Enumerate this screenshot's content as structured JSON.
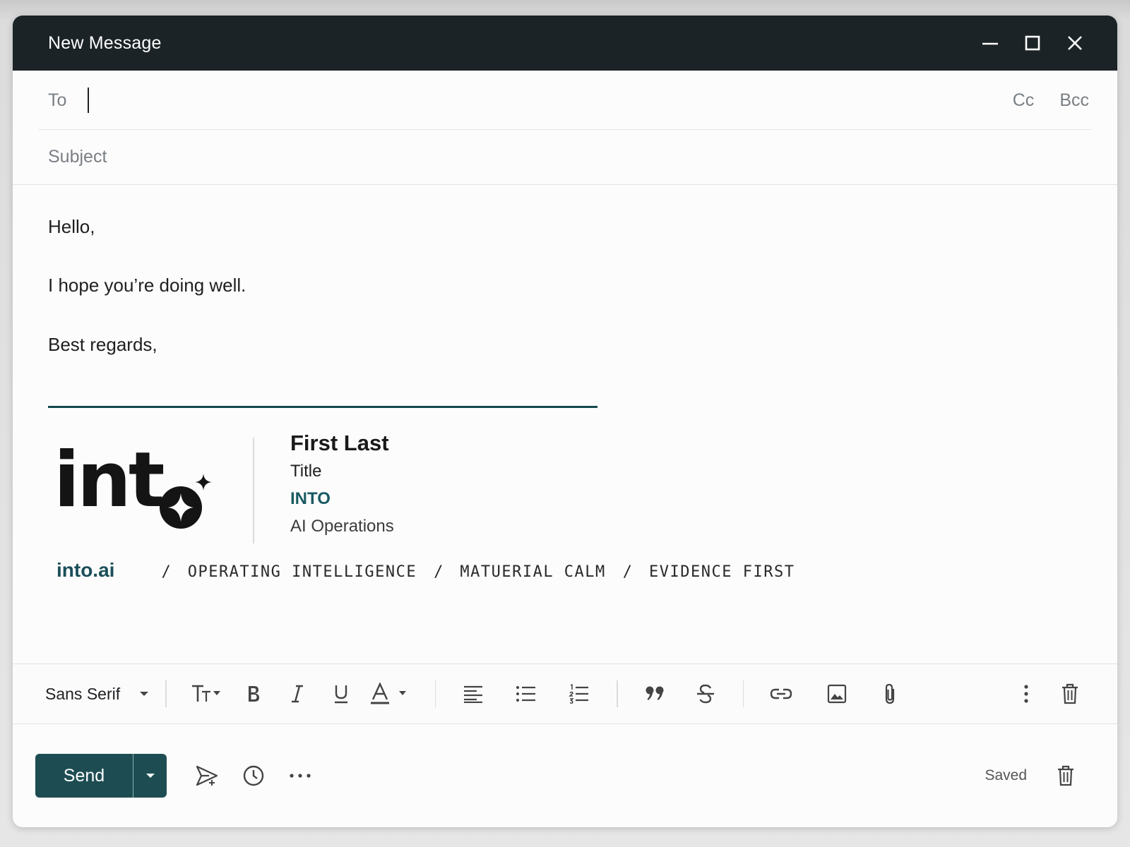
{
  "window": {
    "title": "New Message",
    "controls": [
      "minimize-icon",
      "maximize-icon",
      "close-icon"
    ],
    "titlebar_color": "#1b2326"
  },
  "header": {
    "to_label": "To",
    "to_value": "",
    "cc_label": "Cc",
    "bcc_label": "Bcc",
    "subject_placeholder": "Subject",
    "subject_value": ""
  },
  "body": {
    "lines": [
      "Hello,",
      "I hope you’re doing well.",
      "Best regards,"
    ]
  },
  "signature": {
    "logo_text": "into",
    "name": "First Last",
    "title": "Title",
    "company": "INTO",
    "department": "AI Operations",
    "website": "into.ai",
    "taglines": [
      "OPERATING INTELLIGENCE",
      "MATUERIAL CALM",
      "EVIDENCE FIRST"
    ],
    "separator": "/",
    "accent_color": "#1a5a63",
    "rule_color": "#14484d"
  },
  "toolbar": {
    "font_family": "Sans Serif",
    "buttons": [
      "text-size-icon",
      "bold-icon",
      "italic-icon",
      "underline-icon",
      "text-color-icon",
      "align-icon",
      "bulleted-list-icon",
      "numbered-list-icon",
      "quote-icon",
      "strikethrough-icon",
      "link-icon",
      "image-icon",
      "attachment-icon",
      "more-options-icon",
      "delete-icon"
    ]
  },
  "footer": {
    "send_label": "Send",
    "send_color": "#1d4d52",
    "status": "Saved",
    "icons": [
      "send-options-dropdown-icon",
      "schedule-send-icon",
      "schedule-clock-icon",
      "more-icon",
      "discard-draft-icon"
    ]
  }
}
